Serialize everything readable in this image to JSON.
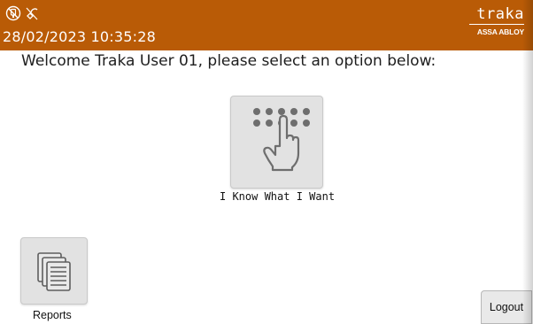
{
  "header": {
    "datetime": "28/02/2023 10:35:28",
    "brand_name": "traka",
    "brand_sub": "ASSA ABLOY",
    "status_icons": [
      "no-network-icon",
      "power-off-icon"
    ],
    "bar_color": "#b95b06"
  },
  "main": {
    "welcome": "Welcome Traka User 01, please select an option below:",
    "primary_option": {
      "label": "I Know What I Want",
      "icon": "keypad-touch-icon"
    }
  },
  "footer": {
    "reports": {
      "label": "Reports",
      "icon": "documents-icon"
    },
    "logout_label": "Logout"
  }
}
